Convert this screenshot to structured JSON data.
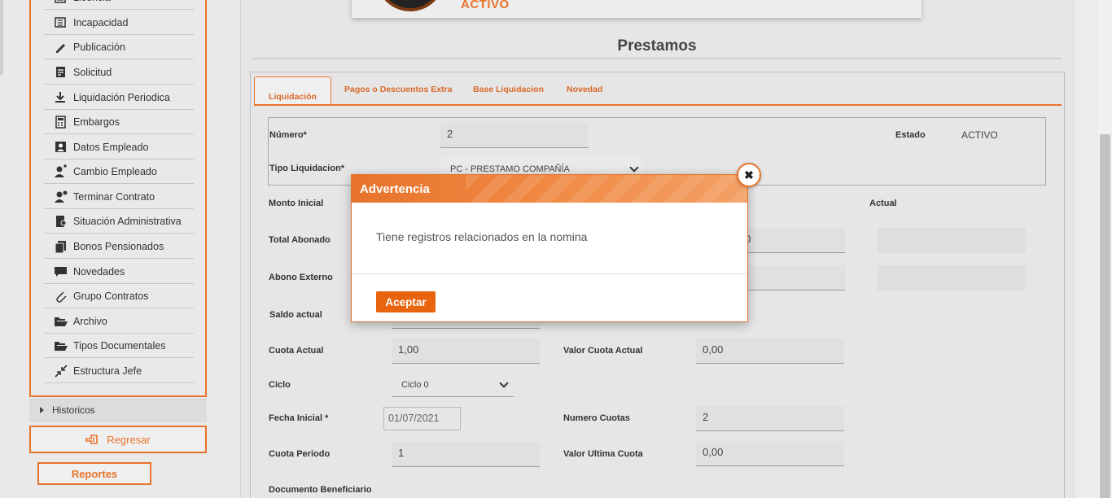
{
  "sidebar": {
    "items": [
      {
        "label": "Licencia",
        "icon": "list-icon"
      },
      {
        "label": "Incapacidad",
        "icon": "first-aid-icon"
      },
      {
        "label": "Publicación",
        "icon": "pencil-icon"
      },
      {
        "label": "Solicitud",
        "icon": "document-icon"
      },
      {
        "label": "Liquidación Periodica",
        "icon": "download-icon"
      },
      {
        "label": "Embargos",
        "icon": "calculator-icon"
      },
      {
        "label": "Datos Empleado",
        "icon": "id-card-icon"
      },
      {
        "label": "Cambio Empleado",
        "icon": "user-change-icon"
      },
      {
        "label": "Terminar Contrato",
        "icon": "user-remove-icon"
      },
      {
        "label": "Situación Administrativa",
        "icon": "document-user-icon"
      },
      {
        "label": "Bonos Pensionados",
        "icon": "stack-icon"
      },
      {
        "label": "Novedades",
        "icon": "comment-icon"
      },
      {
        "label": "Grupo Contratos",
        "icon": "paperclip-icon"
      },
      {
        "label": "Archivo",
        "icon": "folder-open-icon"
      },
      {
        "label": "Tipos Documentales",
        "icon": "folder-open-icon"
      },
      {
        "label": "Estructura Jefe",
        "icon": "compress-icon"
      }
    ],
    "historicos": "Historicos",
    "regresar": "Regresar",
    "reportes": "Reportes"
  },
  "header": {
    "status_top": "ACTIVO"
  },
  "main": {
    "title": "Prestamos",
    "tabs": [
      {
        "label": "Liquidación"
      },
      {
        "label": "Pagos o Descuentos Extra"
      },
      {
        "label": "Base Liquidacion"
      },
      {
        "label": "Novedad"
      }
    ],
    "form": {
      "numero_label": "Número*",
      "numero_value": "2",
      "estado_label": "Estado",
      "estado_value": "ACTIVO",
      "tipo_label": "Tipo Liquidacion*",
      "tipo_value": "PC - PRESTAMO COMPAÑÍA",
      "monto_inicial_label": "Monto Inicial",
      "actual_label": "Actual",
      "total_abonado_label": "Total Abonado",
      "total_abonado_partial": "0",
      "abono_externo_label": "Abono Externo",
      "saldo_actual_label": "Saldo actual",
      "cuota_actual_label": "Cuota Actual",
      "cuota_actual_value": "1,00",
      "valor_cuota_actual_label": "Valor Cuota Actual",
      "valor_cuota_actual_value": "0,00",
      "ciclo_label": "Ciclo",
      "ciclo_value": "Ciclo 0",
      "fecha_inicial_label": "Fecha Inicial *",
      "fecha_inicial_value": "01/07/2021",
      "numero_cuotas_label": "Numero Cuotas",
      "numero_cuotas_value": "2",
      "cuota_periodo_label": "Cuota Periodo",
      "cuota_periodo_value": "1",
      "valor_ultima_cuota_label": "Valor Ultima Cuota",
      "valor_ultima_cuota_value": "0,00",
      "documento_beneficiario_label": "Documento Beneficiario"
    }
  },
  "modal": {
    "title": "Advertencia",
    "message": "Tiene registros relacionados en la nomina",
    "accept_label": "Aceptar",
    "close_glyph": "✖"
  },
  "colors": {
    "accent": "#e8732b",
    "button": "#e8640f"
  }
}
